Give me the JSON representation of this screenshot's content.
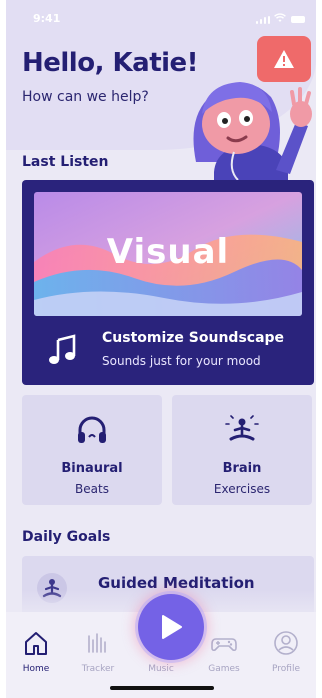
{
  "status_bar": {
    "time": "9:41"
  },
  "header": {
    "greeting": "Hello, Katie!",
    "subtitle": "How can we help?"
  },
  "alert_button": {
    "icon": "warning-icon",
    "color": "#ef6a6a"
  },
  "last_listen": {
    "section_title": "Last Listen",
    "artwork_title": "Visual",
    "title": "Customize Soundscape",
    "subtitle": "Sounds just for your mood",
    "icon": "music-note-icon"
  },
  "tiles": [
    {
      "title": "Binaural",
      "subtitle": "Beats",
      "icon": "headphones-icon"
    },
    {
      "title": "Brain",
      "subtitle": "Exercises",
      "icon": "meditation-icon"
    }
  ],
  "daily_goals": {
    "section_title": "Daily Goals",
    "items": [
      {
        "title": "Guided Meditation",
        "icon": "meditation-icon"
      }
    ]
  },
  "nav": {
    "items": [
      {
        "label": "Home",
        "icon": "home-icon",
        "active": true
      },
      {
        "label": "Tracker",
        "icon": "tracker-icon",
        "active": false
      },
      {
        "label": "Music",
        "icon": "play-icon",
        "active": false
      },
      {
        "label": "Games",
        "icon": "gamepad-icon",
        "active": false
      },
      {
        "label": "Profile",
        "icon": "profile-icon",
        "active": false
      }
    ]
  },
  "colors": {
    "primary": "#2a237c",
    "accent": "#7462e6",
    "alert": "#ef6a6a",
    "background": "#ebe9f5"
  }
}
